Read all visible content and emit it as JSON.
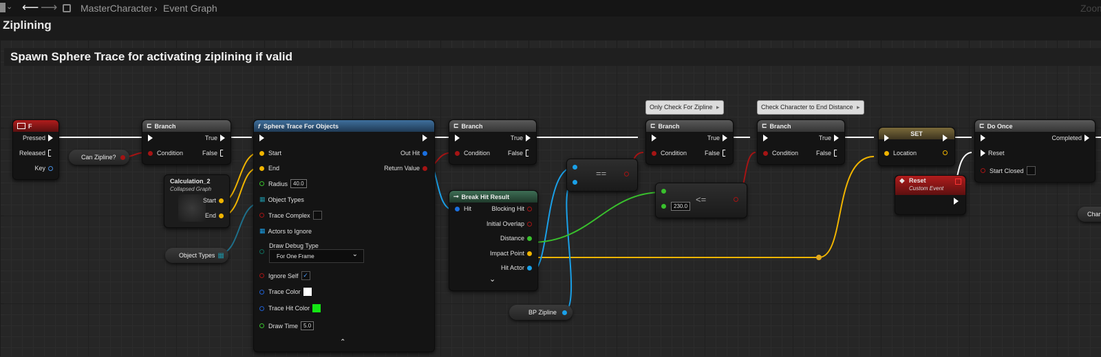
{
  "topbar": {
    "breadcrumb_root": "MasterCharacter",
    "breadcrumb_leaf": "Event Graph",
    "zoom_label": "Zoom"
  },
  "graph_title": "Ziplining",
  "comment": "Spawn Sphere Trace for activating ziplining if valid",
  "colors": {
    "exec": "#ffffff",
    "bool": "#a51414",
    "vector": "#f0b400",
    "object": "#1aa0e8",
    "float": "#39c02d",
    "struct": "#1e6f8a",
    "accent_func": "#3f6f9c"
  },
  "nodes": {
    "input_f": {
      "title": "F",
      "pressed": "Pressed",
      "released": "Released",
      "key": "Key"
    },
    "can_zipline": {
      "label": "Can Zipline?"
    },
    "branch1": {
      "title": "Branch",
      "condition": "Condition",
      "true": "True",
      "false": "False"
    },
    "calculation": {
      "title": "Calculation_2",
      "subtitle": "Collapsed Graph",
      "start": "Start",
      "end": "End"
    },
    "object_types_var": {
      "label": "Object Types"
    },
    "sphere_trace": {
      "title": "Sphere Trace For Objects",
      "start": "Start",
      "end": "End",
      "radius": "Radius",
      "radius_value": "40.0",
      "object_types": "Object Types",
      "trace_complex": "Trace Complex",
      "actors_to_ignore": "Actors to Ignore",
      "draw_debug_type": "Draw Debug Type",
      "draw_debug_value": "For One Frame",
      "ignore_self": "Ignore Self",
      "trace_color": "Trace Color",
      "trace_hit_color": "Trace Hit Color",
      "draw_time": "Draw Time",
      "draw_time_value": "5.0",
      "out_hit": "Out Hit",
      "return_value": "Return Value"
    },
    "branch2": {
      "title": "Branch",
      "condition": "Condition",
      "true": "True",
      "false": "False"
    },
    "break_hit": {
      "title": "Break Hit Result",
      "hit": "Hit",
      "blocking_hit": "Blocking Hit",
      "initial_overlap": "Initial Overlap",
      "distance": "Distance",
      "impact_point": "Impact Point",
      "hit_actor": "Hit Actor"
    },
    "equals": {
      "op": "=="
    },
    "lessequal": {
      "op": "<=",
      "value": "230.0"
    },
    "bp_zipline": {
      "label": "BP Zipline"
    },
    "branch3": {
      "title": "Branch",
      "condition": "Condition",
      "true": "True",
      "false": "False",
      "bubble": "Only Check For Zipline"
    },
    "branch4": {
      "title": "Branch",
      "condition": "Condition",
      "true": "True",
      "false": "False",
      "bubble": "Check Character to End Distance"
    },
    "set": {
      "title": "SET",
      "location": "Location"
    },
    "reset_event": {
      "title": "Reset",
      "subtitle": "Custom Event"
    },
    "do_once": {
      "title": "Do Once",
      "reset": "Reset",
      "start_closed": "Start Closed",
      "completed": "Completed"
    },
    "offscreen": {
      "label": "Chara"
    }
  }
}
